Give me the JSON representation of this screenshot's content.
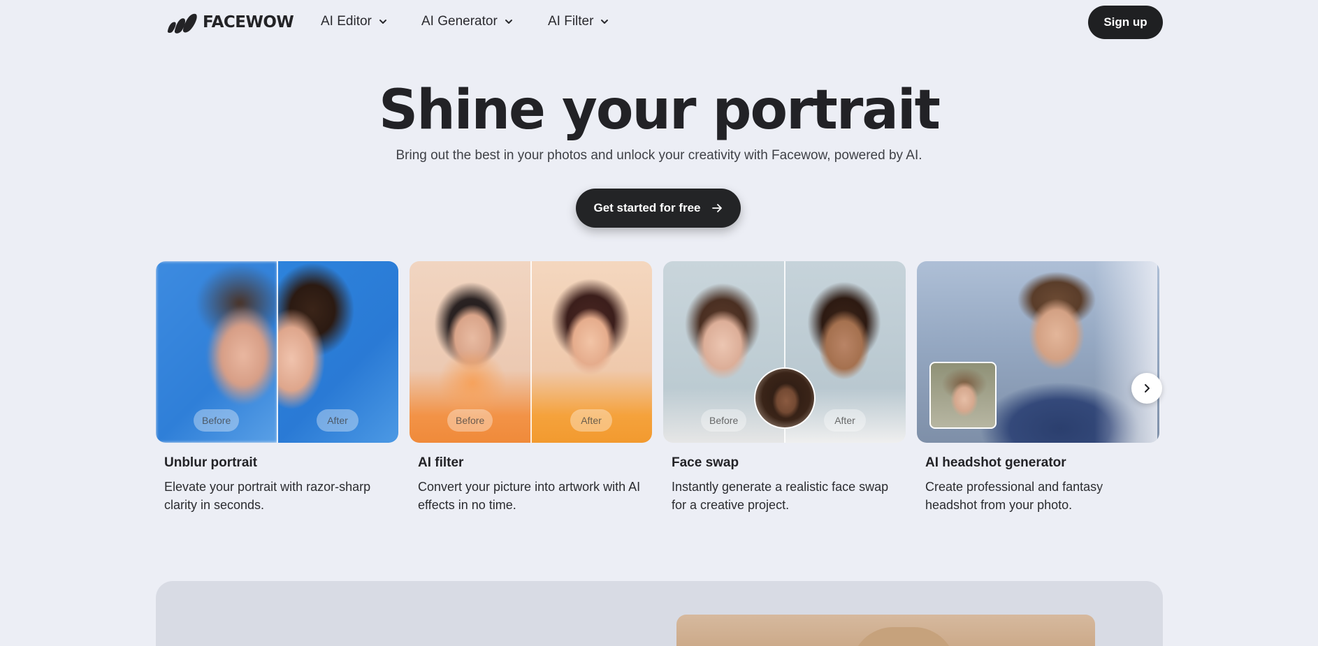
{
  "nav": {
    "brand": "FACEWOW",
    "menus": [
      {
        "label": "AI Editor"
      },
      {
        "label": "AI Generator"
      },
      {
        "label": "AI Filter"
      }
    ],
    "signup_label": "Sign up"
  },
  "hero": {
    "title": "Shine your portrait",
    "subtitle": "Bring out the best in your photos and unlock your creativity with Facewow, powered by AI.",
    "cta_label": "Get started for free"
  },
  "cards": [
    {
      "title": "Unblur portrait",
      "desc": "Elevate your portrait with razor-sharp clarity in seconds.",
      "before": "Before",
      "after": "After"
    },
    {
      "title": "AI filter",
      "desc": "Convert your picture into artwork with AI effects in no time.",
      "before": "Before",
      "after": "After"
    },
    {
      "title": "Face swap",
      "desc": "Instantly generate a realistic face swap for a creative project.",
      "before": "Before",
      "after": "After"
    },
    {
      "title": "AI headshot generator",
      "desc": "Create professional and fantasy headshot from your photo."
    }
  ],
  "icons": {
    "menu_chevron": "chevron-down-icon",
    "cta_arrow": "arrow-right-icon",
    "carousel_next": "chevron-right-icon"
  },
  "colors": {
    "background": "#eceef5",
    "primary_dark": "#1f2022",
    "text": "#222226"
  }
}
